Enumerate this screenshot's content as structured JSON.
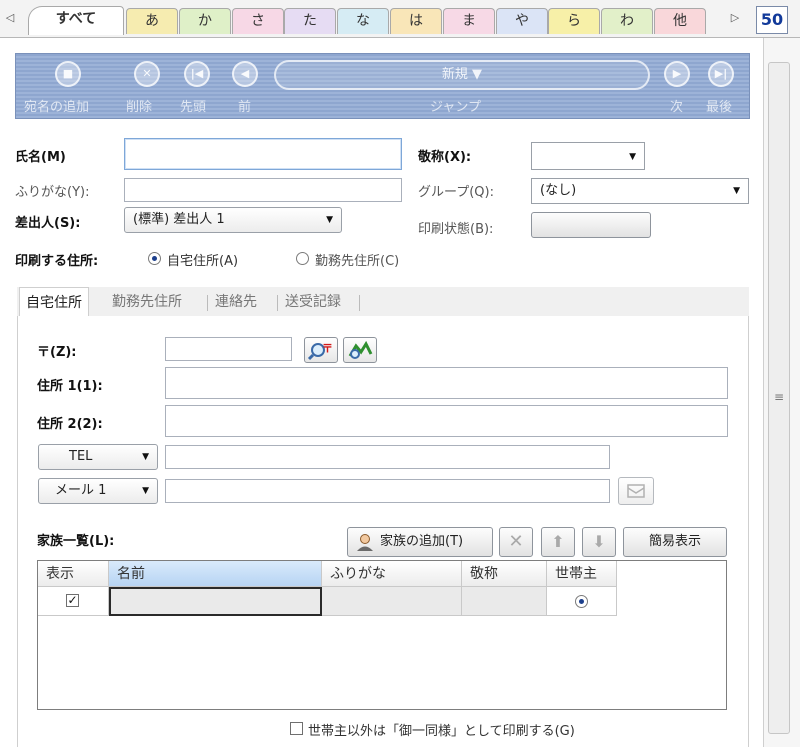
{
  "kana_tabs": [
    {
      "label": "すべて",
      "color": "#ffffff",
      "active": true
    },
    {
      "label": "あ",
      "color": "#f6ecb0"
    },
    {
      "label": "か",
      "color": "#dff0c8"
    },
    {
      "label": "さ",
      "color": "#f7d8e6"
    },
    {
      "label": "た",
      "color": "#e6dcf3"
    },
    {
      "label": "な",
      "color": "#d6ecf4"
    },
    {
      "label": "は",
      "color": "#f9e6b8"
    },
    {
      "label": "ま",
      "color": "#f7d9e6"
    },
    {
      "label": "や",
      "color": "#dbe4f6"
    },
    {
      "label": "ら",
      "color": "#f7f0a8"
    },
    {
      "label": "わ",
      "color": "#e2f0c9"
    },
    {
      "label": "他",
      "color": "#f9d7da"
    }
  ],
  "record_count": "50",
  "toolbar": {
    "add_label": "宛名の追加",
    "delete_label": "削除",
    "first_label": "先頭",
    "prev_label": "前",
    "jump_value": "新規 ▼",
    "jump_label": "ジャンプ",
    "next_label": "次",
    "last_label": "最後"
  },
  "form": {
    "name_label": "氏名(M)",
    "name_value": "",
    "furigana_label": "ふりがな(Y):",
    "furigana_value": "",
    "sender_label": "差出人(S):",
    "sender_value": "(標準) 差出人 1",
    "honorific_label": "敬称(X):",
    "honorific_value": "",
    "group_label": "グループ(Q):",
    "group_value": "(なし)",
    "print_status_label": "印刷状態(B):",
    "print_address_label": "印刷する住所:",
    "home_address_option": "自宅住所(A)",
    "work_address_option": "勤務先住所(C)"
  },
  "address_tabs": [
    "自宅住所",
    "勤務先住所",
    "連絡先",
    "送受記録"
  ],
  "address": {
    "postal_label": "〒(Z):",
    "postal_value": "",
    "address1_label": "住所 1(1):",
    "address1_value": "",
    "address2_label": "住所 2(2):",
    "address2_value": "",
    "phone_type": "TEL",
    "phone_value": "",
    "mail_type": "メール 1",
    "mail_value": ""
  },
  "family": {
    "label": "家族一覧(L):",
    "add_button": "家族の追加(T)",
    "simple_view_button": "簡易表示",
    "columns": [
      "表示",
      "名前",
      "ふりがな",
      "敬称",
      "世帯主"
    ],
    "rows": [
      {
        "show": "✓",
        "name": "",
        "furigana": "",
        "honorific": "",
        "head": true
      }
    ],
    "same_household_label": "世帯主以外は「御一同様」として印刷する(G)"
  }
}
